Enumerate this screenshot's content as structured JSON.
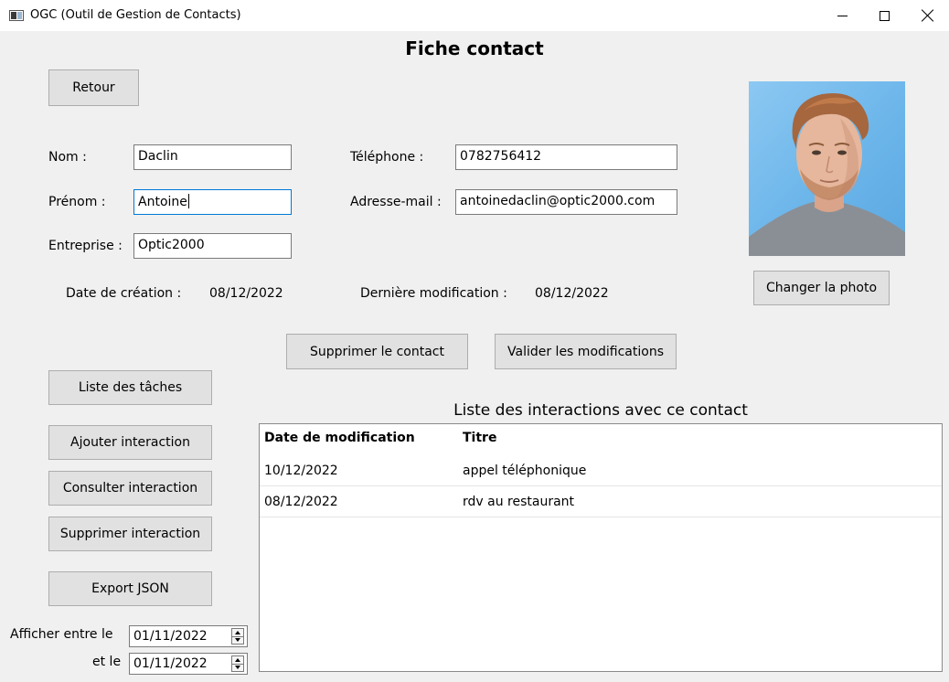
{
  "window": {
    "title": "OGC (Outil de Gestion de Contacts)"
  },
  "page": {
    "heading": "Fiche contact"
  },
  "buttons": {
    "back": "Retour",
    "change_photo": "Changer la photo",
    "delete_contact": "Supprimer le contact",
    "validate_changes": "Valider les modifications",
    "task_list": "Liste des tâches",
    "add_interaction": "Ajouter interaction",
    "view_interaction": "Consulter interaction",
    "delete_interaction": "Supprimer interaction",
    "export_json": "Export JSON"
  },
  "form": {
    "last_name_label": "Nom :",
    "last_name_value": "Daclin",
    "first_name_label": "Prénom :",
    "first_name_value": "Antoine",
    "company_label": "Entreprise :",
    "company_value": "Optic2000",
    "phone_label": "Téléphone :",
    "phone_value": "0782756412",
    "email_label": "Adresse-mail :",
    "email_value": "antoinedaclin@optic2000.com"
  },
  "meta": {
    "created_label": "Date de création :",
    "created_value": "08/12/2022",
    "modified_label": "Dernière modification :",
    "modified_value": "08/12/2022"
  },
  "interactions": {
    "title": "Liste des interactions avec ce contact",
    "columns": [
      "Date de modification",
      "Titre"
    ],
    "rows": [
      [
        "10/12/2022",
        "appel téléphonique"
      ],
      [
        "08/12/2022",
        "rdv au restaurant"
      ]
    ]
  },
  "filter": {
    "from_label": "Afficher entre le",
    "from_value": "01/11/2022",
    "to_label": "et le",
    "to_value": "01/11/2022"
  },
  "icons": {
    "app": "app-window-icon",
    "minimize": "minimize-icon",
    "maximize": "maximize-icon",
    "close": "close-icon",
    "spin": "spin-arrows-icon"
  }
}
